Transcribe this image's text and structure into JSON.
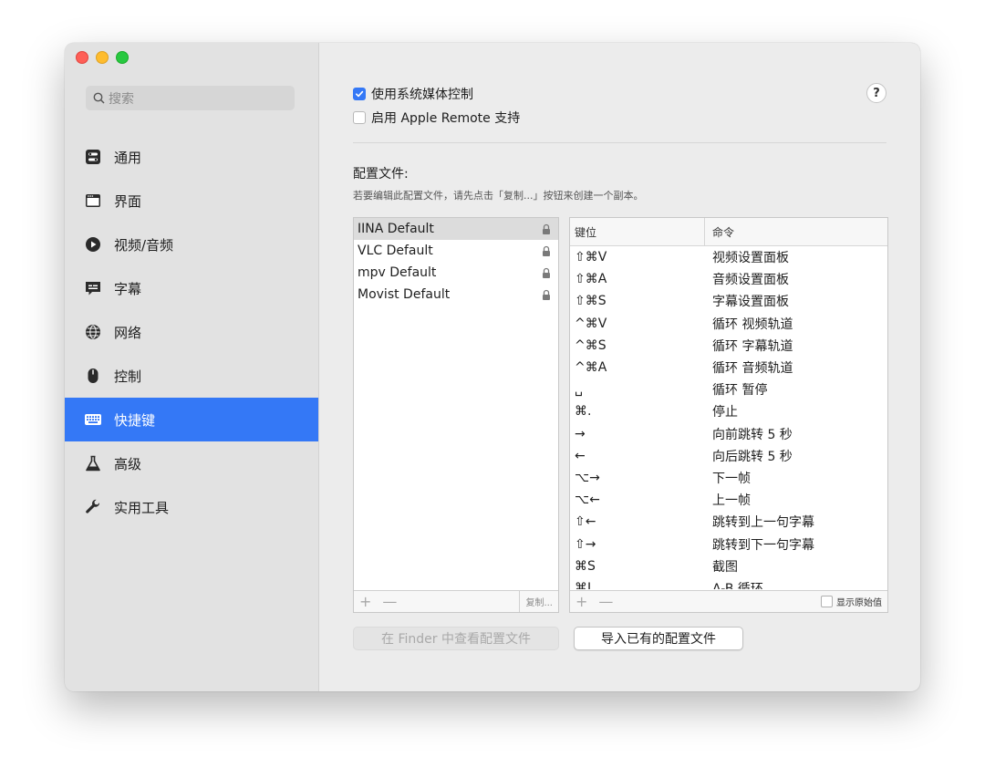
{
  "search": {
    "placeholder": "搜索"
  },
  "sidebar": {
    "items": [
      {
        "label": "通用",
        "icon": "switches-icon"
      },
      {
        "label": "界面",
        "icon": "window-icon"
      },
      {
        "label": "视频/音频",
        "icon": "play-icon"
      },
      {
        "label": "字幕",
        "icon": "subtitle-icon"
      },
      {
        "label": "网络",
        "icon": "globe-icon"
      },
      {
        "label": "控制",
        "icon": "mouse-icon"
      },
      {
        "label": "快捷键",
        "icon": "keyboard-icon",
        "active": true
      },
      {
        "label": "高级",
        "icon": "flask-icon"
      },
      {
        "label": "实用工具",
        "icon": "wrench-icon"
      }
    ]
  },
  "main": {
    "use_system_media_control": {
      "label": "使用系统媒体控制",
      "checked": true
    },
    "enable_apple_remote": {
      "label": "启用 Apple Remote 支持",
      "checked": false
    },
    "help_label": "?",
    "section_title": "配置文件:",
    "section_desc": "若要编辑此配置文件，请先点击「复制...」按钮来创建一个副本。",
    "profiles": [
      {
        "name": "IINA Default",
        "locked": true,
        "selected": true
      },
      {
        "name": "VLC Default",
        "locked": true
      },
      {
        "name": "mpv Default",
        "locked": true
      },
      {
        "name": "Movist Default",
        "locked": true
      }
    ],
    "profile_footer": {
      "add": "+",
      "remove": "—",
      "copy": "复制..."
    },
    "keys_header": {
      "key": "键位",
      "command": "命令"
    },
    "bindings": [
      {
        "key": "⇧⌘V",
        "command": "视频设置面板"
      },
      {
        "key": "⇧⌘A",
        "command": "音频设置面板"
      },
      {
        "key": "⇧⌘S",
        "command": "字幕设置面板"
      },
      {
        "key": "^⌘V",
        "command": "循环 视频轨道"
      },
      {
        "key": "^⌘S",
        "command": "循环 字幕轨道"
      },
      {
        "key": "^⌘A",
        "command": "循环 音频轨道"
      },
      {
        "key": "␣",
        "command": "循环 暂停"
      },
      {
        "key": "⌘.",
        "command": "停止"
      },
      {
        "key": "→",
        "command": "向前跳转 5 秒"
      },
      {
        "key": "←",
        "command": "向后跳转 5 秒"
      },
      {
        "key": "⌥→",
        "command": "下一帧"
      },
      {
        "key": "⌥←",
        "command": "上一帧"
      },
      {
        "key": "⇧←",
        "command": "跳转到上一句字幕"
      },
      {
        "key": "⇧→",
        "command": "跳转到下一句字幕"
      },
      {
        "key": "⌘S",
        "command": "截图"
      },
      {
        "key": "⌘L",
        "command": "A-B 循环"
      }
    ],
    "keys_footer": {
      "add": "+",
      "remove": "—",
      "show_raw": "显示原始值"
    },
    "finder_button": "在 Finder 中查看配置文件",
    "import_button": "导入已有的配置文件"
  },
  "colors": {
    "accent": "#3478f6",
    "sidebar_bg": "#e2e2e2",
    "window_bg": "#ececec"
  }
}
